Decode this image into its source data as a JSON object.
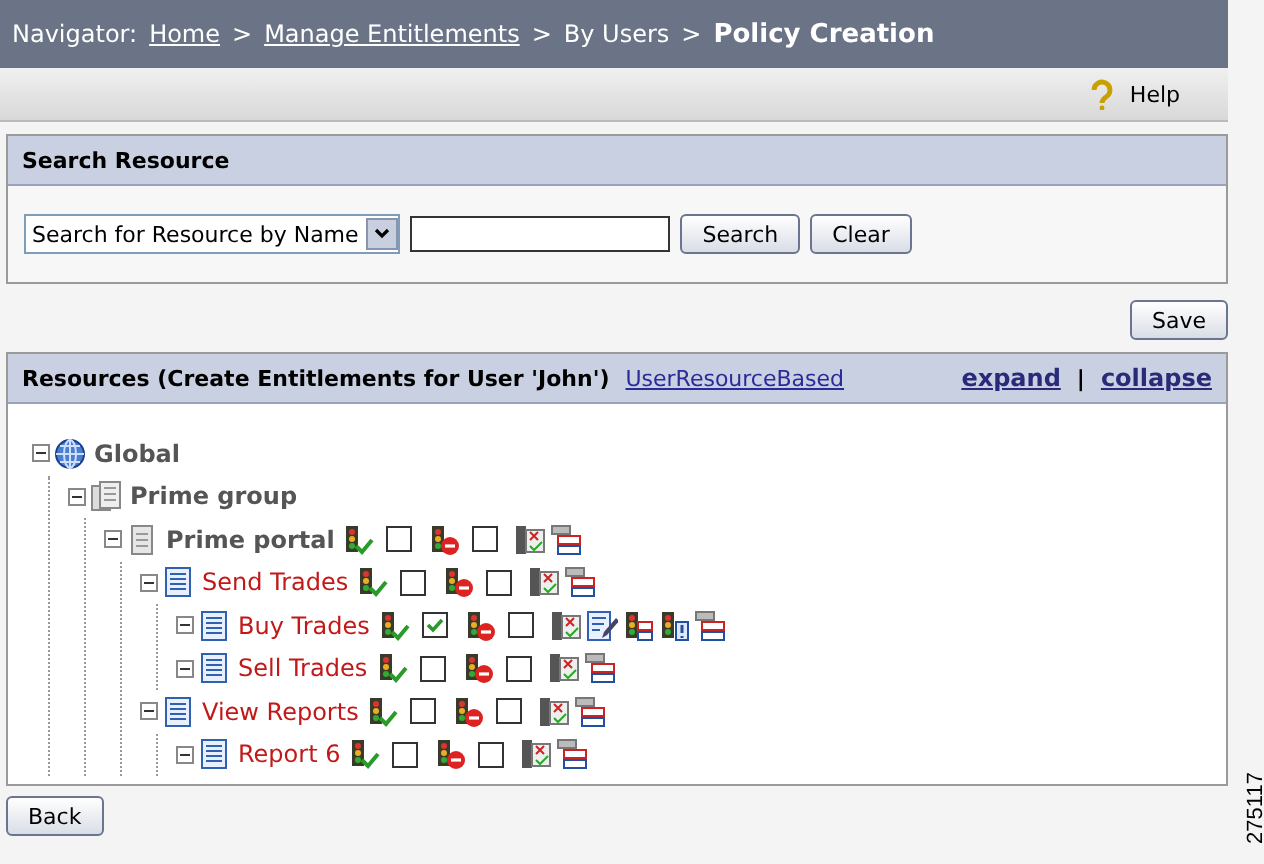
{
  "navigator": {
    "label": "Navigator:",
    "crumbs": [
      {
        "text": "Home",
        "link": true,
        "sep": ">"
      },
      {
        "text": "Manage Entitlements",
        "link": true,
        "sep": ">"
      },
      {
        "text": "By Users",
        "link": false,
        "sep": ">"
      }
    ],
    "current": "Policy Creation"
  },
  "toolbar": {
    "help": "Help"
  },
  "search_panel": {
    "title": "Search Resource",
    "select": "Search for Resource by Name",
    "buttons": [
      "Search",
      "Clear"
    ]
  },
  "save_button": "Save",
  "resources_panel": {
    "title": "Resources (Create Entitlements for User 'John')",
    "link": "UserResourceBased",
    "expand": "expand",
    "separator": "|",
    "collapse": "collapse",
    "tree": [
      {
        "label": "Global",
        "kind": "root",
        "expanded": true,
        "children": [
          {
            "label": "Prime group",
            "kind": "group",
            "expanded": true,
            "children": [
              {
                "label": "Prime portal",
                "kind": "portal",
                "expanded": true,
                "allow_checked": false,
                "deny_checked": false,
                "extended": false,
                "children": [
                  {
                    "label": "Send Trades",
                    "kind": "page",
                    "expanded": true,
                    "allow_checked": false,
                    "deny_checked": false,
                    "extended": false,
                    "children": [
                      {
                        "label": "Buy Trades",
                        "kind": "page",
                        "expanded": true,
                        "allow_checked": true,
                        "deny_checked": false,
                        "extended": true
                      },
                      {
                        "label": "Sell Trades",
                        "kind": "page",
                        "expanded": true,
                        "allow_checked": false,
                        "deny_checked": false,
                        "extended": false
                      }
                    ]
                  },
                  {
                    "label": "View Reports",
                    "kind": "page",
                    "expanded": true,
                    "allow_checked": false,
                    "deny_checked": false,
                    "extended": false,
                    "children": [
                      {
                        "label": "Report 6",
                        "kind": "page",
                        "expanded": true,
                        "allow_checked": false,
                        "deny_checked": false,
                        "extended": false
                      }
                    ]
                  }
                ]
              }
            ]
          }
        ]
      }
    ]
  },
  "back_button": "Back",
  "figure_id": "275117"
}
